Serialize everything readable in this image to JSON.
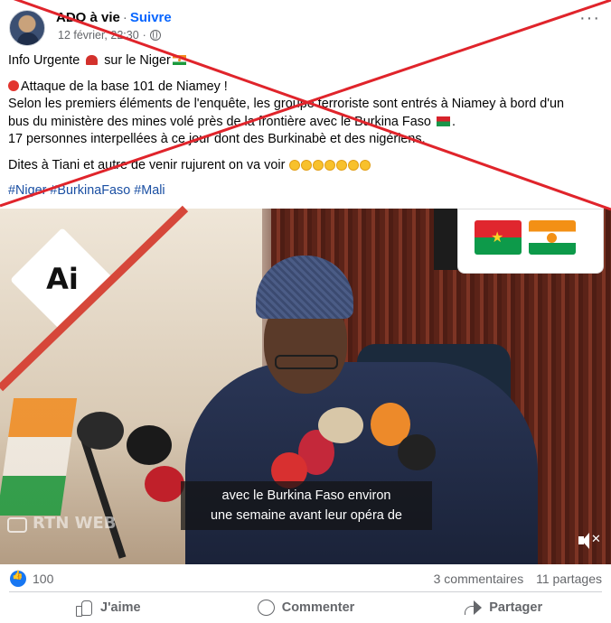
{
  "post": {
    "author": "ADO à vie",
    "separator": "·",
    "follow_label": "Suivre",
    "timestamp": "12 février, 22:30",
    "separator_meta": "·",
    "more_label": "···"
  },
  "text": {
    "line1": "Info Urgente",
    "line1b": "sur le Niger",
    "line2": "Attaque de la base 101 de Niamey !",
    "line3": "Selon les premiers éléments de l'enquête, les groupe terroriste sont entrés à Niamey à bord d'un",
    "line4": "bus du ministère des mines volé près de la frontière avec le Burkina Faso",
    "line4b": ".",
    "line5": "17 personnes interpellées à ce jour dont des Burkinabè et des nigériens.",
    "line6": "Dites à Tiani et autre de venir rujurent on va voir",
    "hashtags": [
      "#Niger",
      "#BurkinaFaso",
      "#Mali"
    ]
  },
  "video": {
    "ai_label": "Ai",
    "watermark": "RTN WEB",
    "subtitle_line1": "avec le Burkina Faso environ",
    "subtitle_line2": "une semaine avant leur opéra de"
  },
  "stats": {
    "reactions": "100",
    "comments": "3 commentaires",
    "shares": "11 partages"
  },
  "actions": {
    "like": "J'aime",
    "comment": "Commenter",
    "share": "Partager"
  },
  "colors": {
    "accent": "#0866ff",
    "cross": "#e0242b",
    "muted": "#65676b"
  }
}
